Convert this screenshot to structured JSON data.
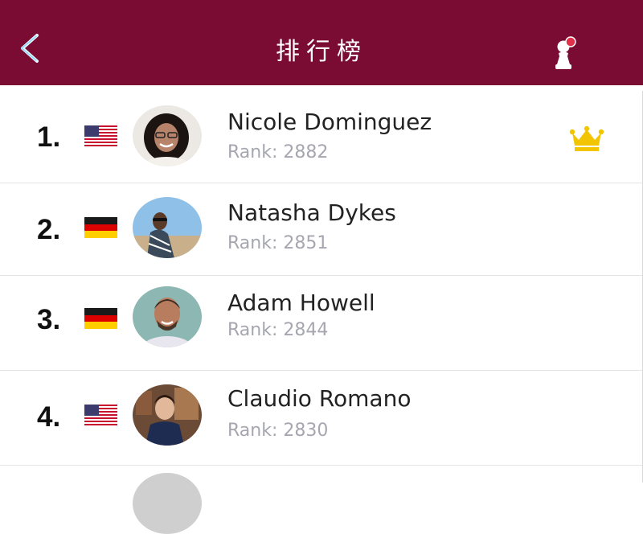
{
  "header": {
    "title": "排行榜",
    "back_icon": "chevron-left-icon",
    "profile_icon": "chess-pawn-icon",
    "background": "#7a0b33",
    "notification_dot_color": "#e0304a"
  },
  "leaderboard": [
    {
      "position": "1.",
      "flag": "US",
      "name": "Nicole Dominguez",
      "rank": "Rank: 2882",
      "crown": true
    },
    {
      "position": "2.",
      "flag": "DE",
      "name": "Natasha Dykes",
      "rank": "Rank: 2851",
      "crown": false
    },
    {
      "position": "3.",
      "flag": "DE",
      "name": "Adam Howell",
      "rank": "Rank: 2844",
      "crown": false
    },
    {
      "position": "4.",
      "flag": "US",
      "name": "Claudio Romano",
      "rank": "Rank: 2830",
      "crown": false
    }
  ],
  "colors": {
    "crown": "#f2c500",
    "rank_text": "#a6a6b0",
    "divider": "#e4e4e4"
  }
}
